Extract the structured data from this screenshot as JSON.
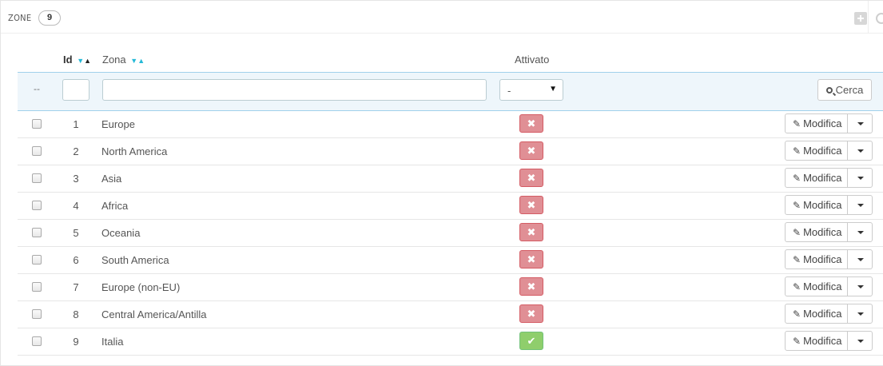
{
  "panel": {
    "title": "ZONE",
    "count": "9"
  },
  "header": {
    "id": "Id",
    "zona": "Zona",
    "attivato": "Attivato"
  },
  "filter": {
    "dash": "--",
    "select_value": "-",
    "search_label": "Cerca",
    "id_value": "",
    "zona_value": ""
  },
  "row_actions": {
    "edit_label": "Modifica"
  },
  "colors": {
    "accent": "#25b9d7",
    "inactive": "#e08f95",
    "active": "#8fce6c"
  },
  "rows": [
    {
      "id": "1",
      "zona": "Europe",
      "active": false
    },
    {
      "id": "2",
      "zona": "North America",
      "active": false
    },
    {
      "id": "3",
      "zona": "Asia",
      "active": false
    },
    {
      "id": "4",
      "zona": "Africa",
      "active": false
    },
    {
      "id": "5",
      "zona": "Oceania",
      "active": false
    },
    {
      "id": "6",
      "zona": "South America",
      "active": false
    },
    {
      "id": "7",
      "zona": "Europe (non-EU)",
      "active": false
    },
    {
      "id": "8",
      "zona": "Central America/Antilla",
      "active": false
    },
    {
      "id": "9",
      "zona": "Italia",
      "active": true
    }
  ]
}
